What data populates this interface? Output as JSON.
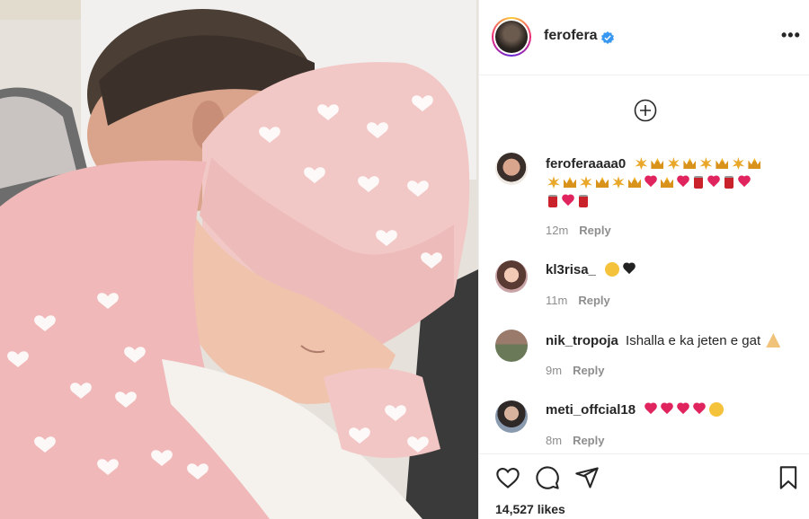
{
  "post": {
    "author": "ferofera",
    "likes": "14,527 likes"
  },
  "comments": [
    {
      "user": "feroferaaaa0",
      "time": "12m",
      "reply": "Reply",
      "emoji": [
        "sparkle",
        "crown",
        "sparkle",
        "crown",
        "sparkle",
        "crown",
        "sparkle",
        "crown",
        "sparkle",
        "crown",
        "sparkle",
        "crown",
        "sparkle",
        "crown",
        "sparkle",
        "crown",
        "heart",
        "crown",
        "heart",
        "can",
        "heart",
        "can",
        "heart",
        "can",
        "heart",
        "can"
      ]
    },
    {
      "user": "kl3risa_",
      "time": "11m",
      "reply": "Reply",
      "emoji": [
        "smiling-face",
        "black-heart"
      ]
    },
    {
      "user": "nik_tropoja",
      "text": "Ishalla e ka jeten e gat",
      "time": "9m",
      "reply": "Reply",
      "emoji": [
        "folded-hands"
      ]
    },
    {
      "user": "meti_offcial18",
      "time": "8m",
      "reply": "Reply",
      "emoji": [
        "heart",
        "heart",
        "heart",
        "heart",
        "star-struck"
      ]
    }
  ],
  "colors": {
    "verified": "#3897f0",
    "heart": "#e0245e",
    "muted": "#8e8e8e",
    "text": "#262626"
  },
  "icons": [
    "verified-badge-icon",
    "more-options-icon",
    "load-more-comments-icon",
    "like-icon",
    "comment-icon",
    "share-icon",
    "save-icon"
  ]
}
